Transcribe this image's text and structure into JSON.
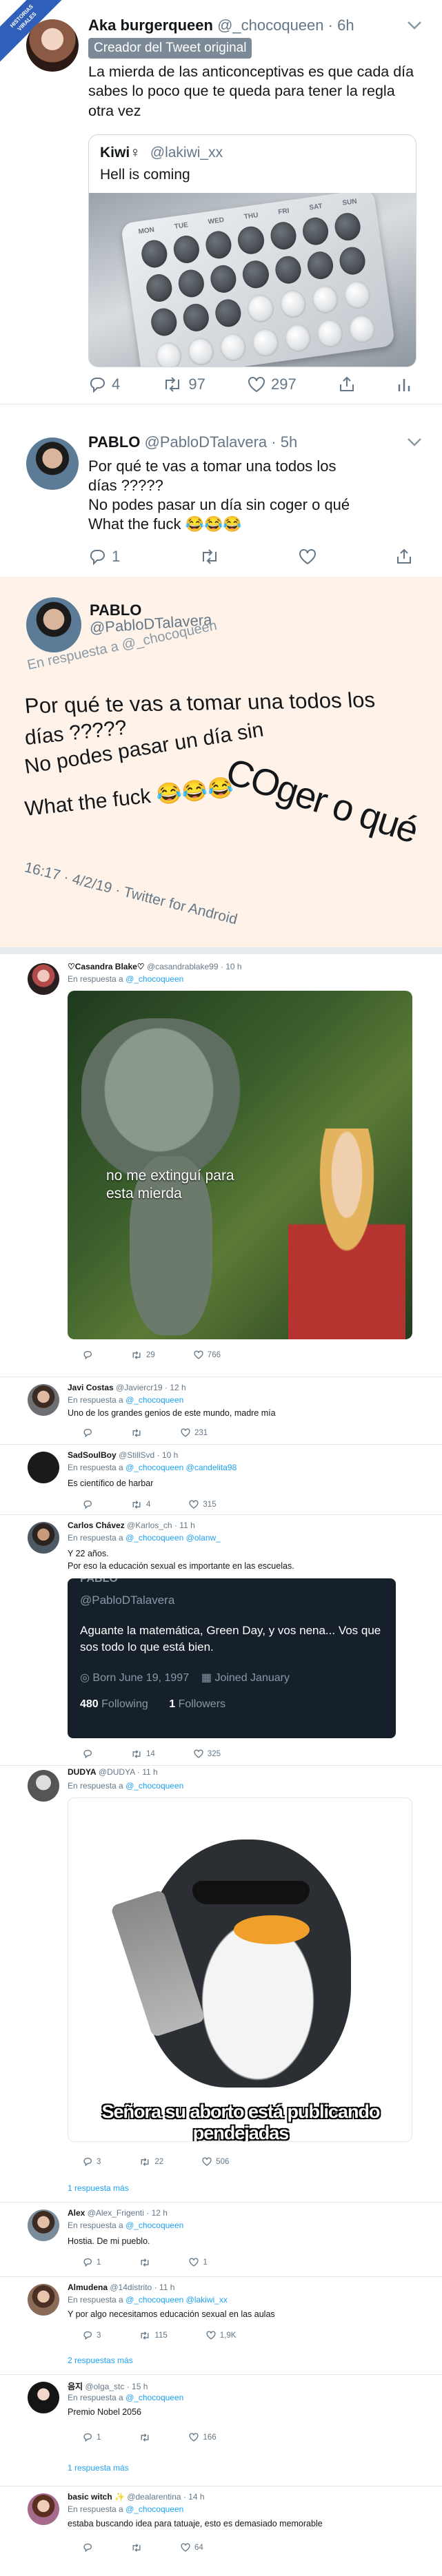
{
  "badge": {
    "line1": "HISTORIAS",
    "line2": "VIRALES",
    "line3": "CONECTADAS"
  },
  "t1": {
    "name": "Aka burgerqueen",
    "handle": "@_chocoqueen",
    "time": "6h",
    "author_tag": "Creador del Tweet original",
    "text": "La mierda de las anticonceptivas es que cada día sabes lo poco que te queda para tener la regla otra vez",
    "quote": {
      "name": "Kiwi♀",
      "handle": "@lakiwi_xx",
      "text": "Hell is coming",
      "pill_days": [
        "MON",
        "TUE",
        "WED",
        "THU",
        "FRI",
        "SAT",
        "SUN"
      ]
    },
    "stats": {
      "replies": "4",
      "retweets": "97",
      "likes": "297"
    }
  },
  "t2": {
    "name": "PABLO",
    "handle": "@PabloDTalavera",
    "time": "5h",
    "lines": [
      "Por qué te vas a tomar una todos los",
      "días ?????",
      "No podes pasar un día sin coger o qué",
      "What the fuck 😂😂😂"
    ],
    "stats": {
      "replies": "1",
      "retweets": "",
      "likes": ""
    }
  },
  "t3": {
    "name": "PABLO",
    "handle": "@PabloDTalavera",
    "reply_line": "En respuesta a @_chocoqueen",
    "line1": "Por qué te vas a tomar una todos los",
    "line2": "días ?????",
    "line3a": "No podes pasar un día sin",
    "line3b": "COger o qué",
    "line4": "What the fuck 😂😂😂",
    "meta": "16:17 · 4/2/19 · Twitter for Android"
  },
  "t4": {
    "name": "♡Casandra Blake♡",
    "handle": "@casandrablake99",
    "time": "10 h",
    "reply": "En respuesta a",
    "reply_to": "@_chocoqueen",
    "meme_text": "no me extinguí para esta mierda",
    "stats": {
      "retweets": "29",
      "likes": "766"
    }
  },
  "t5": {
    "name": "Javi Costas",
    "handle": "@Javiercr19",
    "time": "12 h",
    "reply": "En respuesta a",
    "reply_to": "@_chocoqueen",
    "text": "Uno de los grandes genios de este mundo, madre mía",
    "stats": {
      "retweets": "",
      "likes": "231"
    }
  },
  "t6": {
    "name": "SadSoulBoy",
    "handle": "@StillSvd",
    "time": "10 h",
    "reply": "En respuesta a",
    "reply_to": "@_chocoqueen @candelita98",
    "text": "Es científico de harbar",
    "stats": {
      "retweets": "4",
      "likes": "315"
    }
  },
  "t7": {
    "name": "Carlos Chávez",
    "handle": "@Karlos_ch",
    "time": "11 h",
    "reply": "En respuesta a",
    "reply_to": "@_chocoqueen @olanw_",
    "text1": "Y 22 años.",
    "text2": "Por eso la educación sexual es importante en las escuelas.",
    "card": {
      "top": "PABLO",
      "handle": "@PabloDTalavera",
      "bio": "Aguante la matemática, Green Day, y vos nena... Vos que sos todo lo que está bien.",
      "born": "Born June 19, 1997",
      "joined": "Joined January",
      "following_num": "480",
      "following_label": "Following",
      "followers_num": "1",
      "followers_label": "Followers"
    },
    "stats": {
      "retweets": "14",
      "likes": "325"
    }
  },
  "t8": {
    "name": "DUDYA",
    "handle": "@DUDYA",
    "time": "11 h",
    "reply": "En respuesta a",
    "reply_to": "@_chocoqueen",
    "meme_text": "Señora su aborto está publicando pendejadas",
    "stats": {
      "replies": "3",
      "retweets": "22",
      "likes": "506"
    },
    "more": "1 respuesta más"
  },
  "t9": {
    "name": "Alex",
    "handle": "@Alex_Frigenti",
    "time": "12 h",
    "reply": "En respuesta a",
    "reply_to": "@_chocoqueen",
    "text": "Hostia. De mi pueblo.",
    "stats": {
      "replies": "1",
      "retweets": "",
      "likes": "1"
    }
  },
  "t10": {
    "name": "Almudena",
    "handle": "@14distrito",
    "time": "11 h",
    "reply": "En respuesta a",
    "reply_to": "@_chocoqueen @lakiwi_xx",
    "text": "Y por algo necesitamos educación sexual en las aulas",
    "stats": {
      "replies": "3",
      "retweets": "115",
      "likes": "1,9K"
    },
    "more": "2 respuestas más"
  },
  "t11": {
    "name": "음지",
    "handle": "@olga_stc",
    "time": "15 h",
    "reply": "En respuesta a",
    "reply_to": "@_chocoqueen",
    "text": "Premio Nobel 2056",
    "stats": {
      "replies": "1",
      "retweets": "",
      "likes": "166"
    },
    "more": "1 respuesta más"
  },
  "t12": {
    "name": "basic witch",
    "handle": "@dealarentina",
    "time": "14 h",
    "reply": "En respuesta a",
    "reply_to": "@_chocoqueen",
    "text": "estaba buscando idea para tatuaje, esto es demasiado memorable",
    "stats": {
      "retweets": "",
      "likes": "64"
    }
  }
}
